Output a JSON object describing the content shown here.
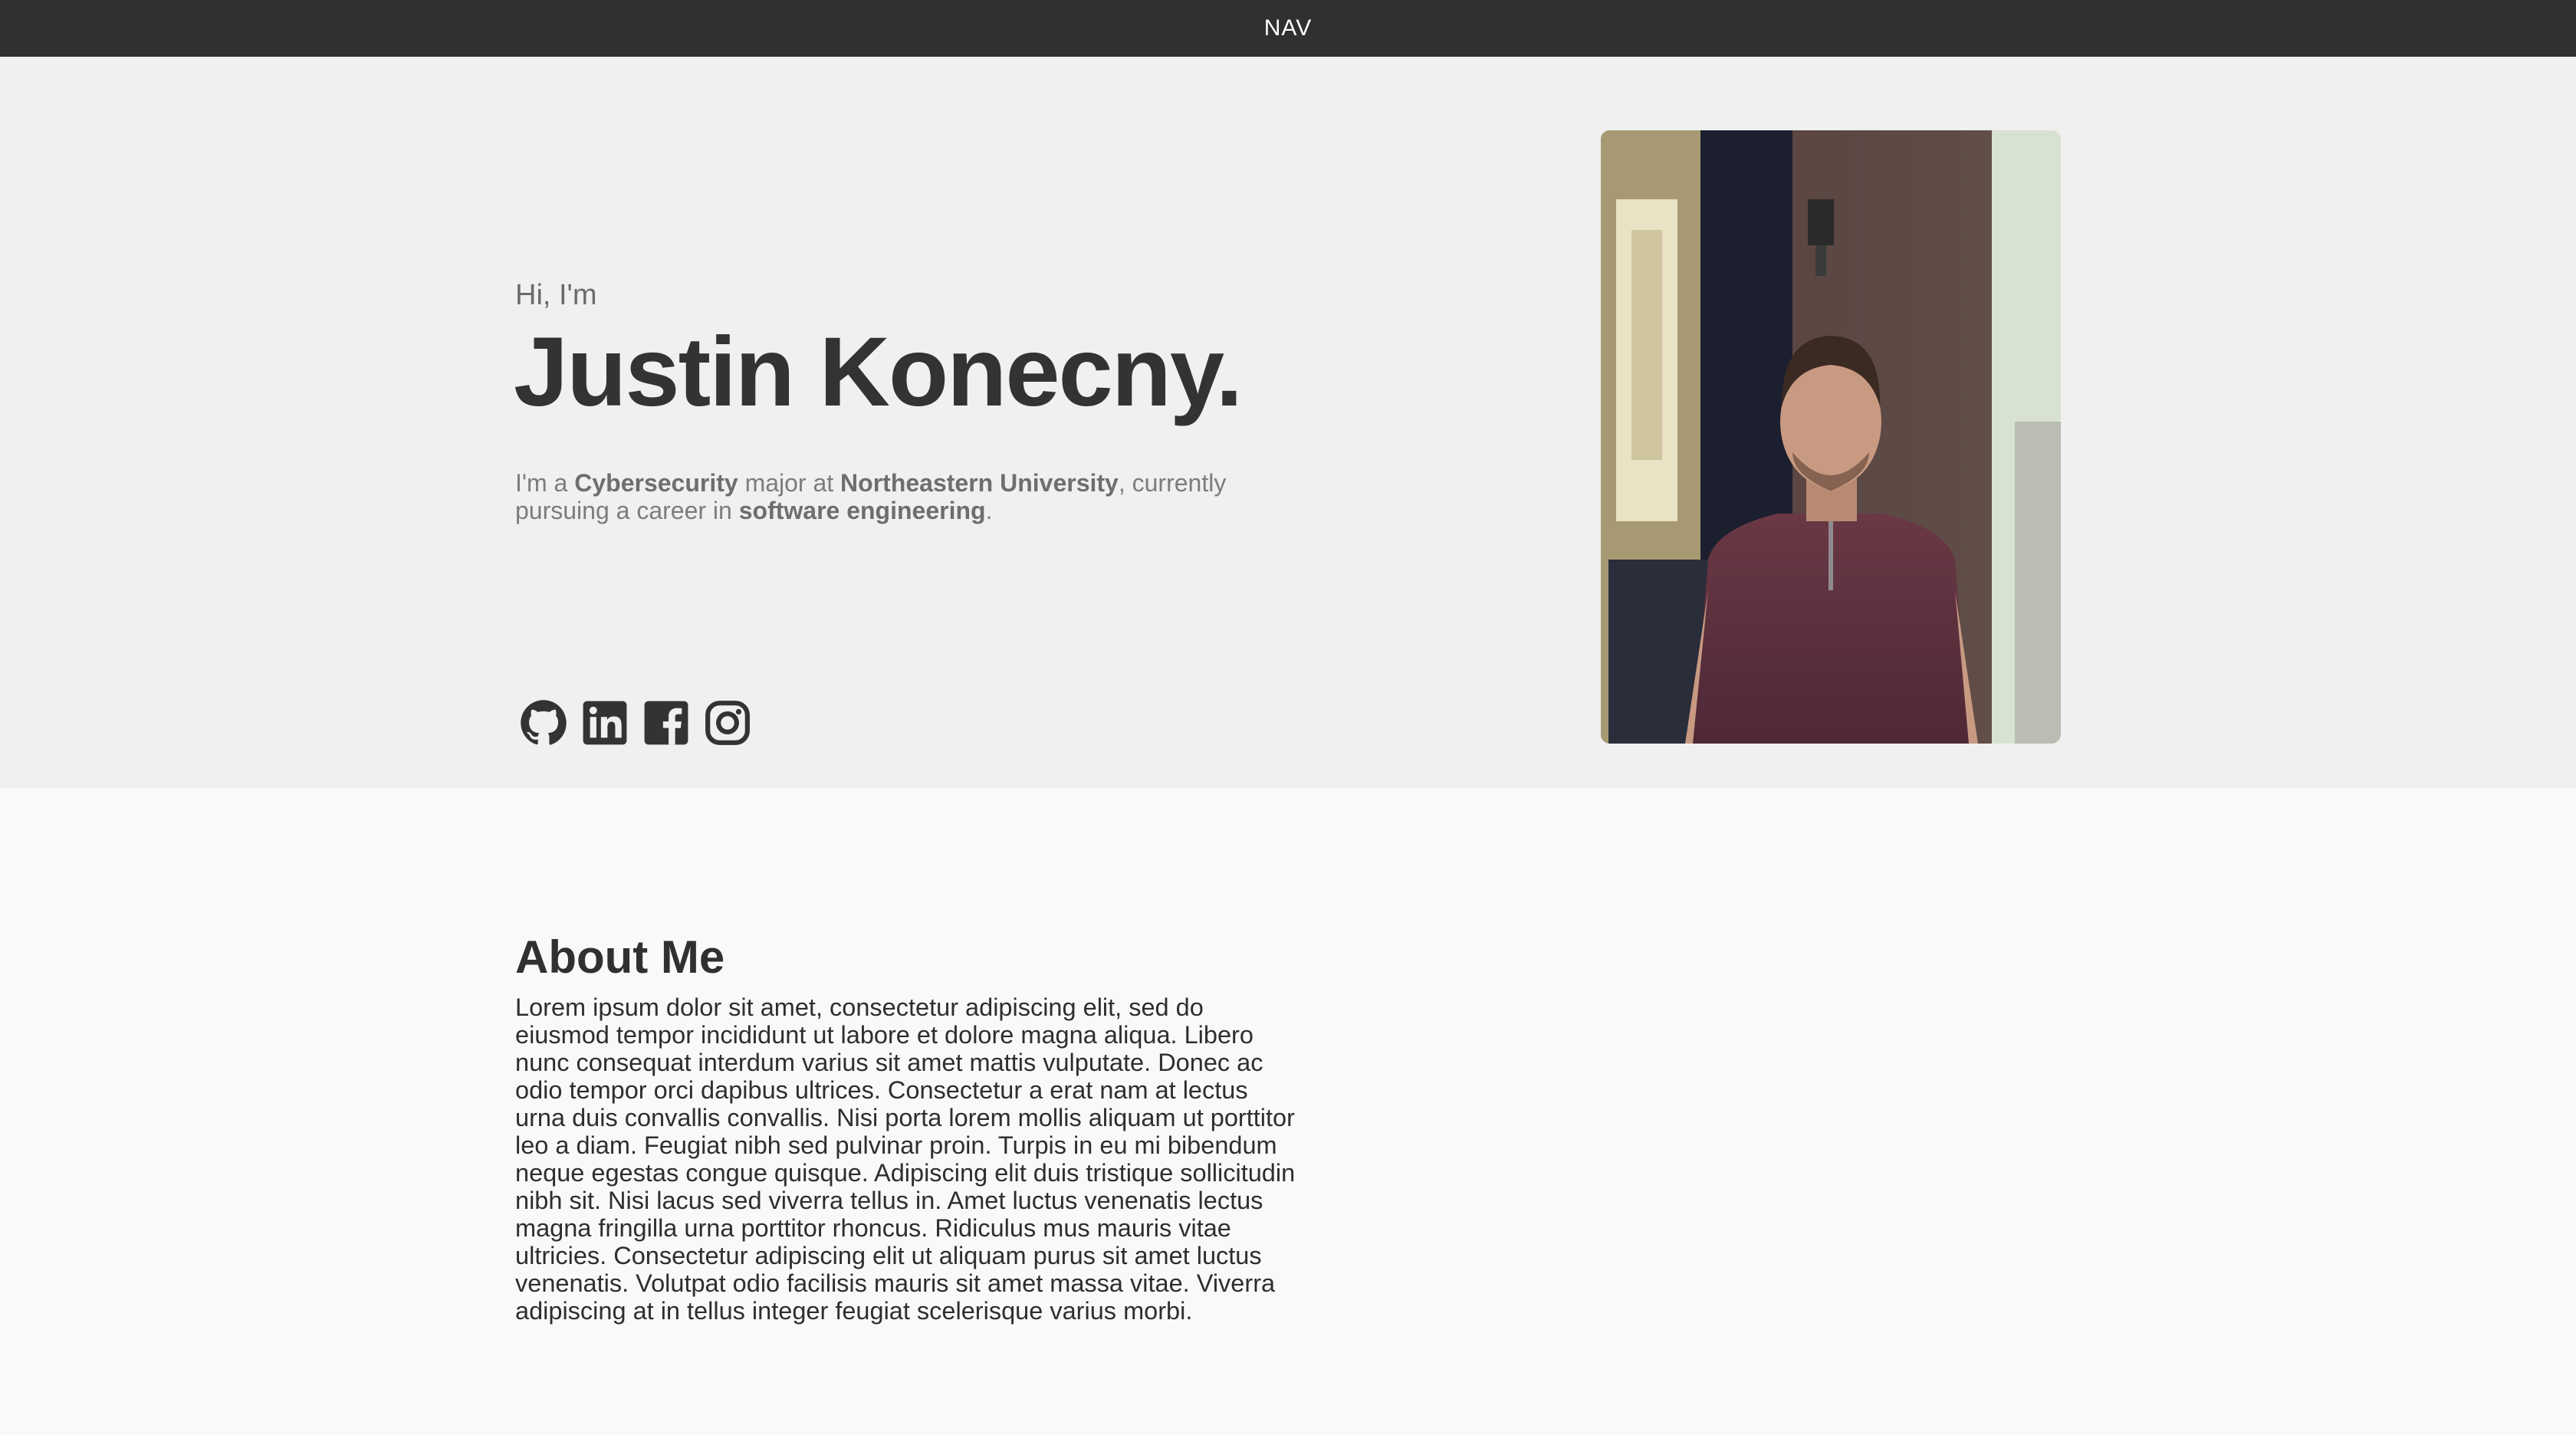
{
  "nav": {
    "label": "NAV"
  },
  "hero": {
    "greeting": "Hi, I'm",
    "name": "Justin Konecny.",
    "desc": {
      "p1": "I'm a ",
      "major": "Cybersecurity",
      "p2": " major at ",
      "university": "Northeastern University",
      "p3": ", currently pursuing a career in ",
      "career": "software engineering",
      "p4": "."
    }
  },
  "socials": [
    {
      "icon": "github-icon"
    },
    {
      "icon": "linkedin-icon"
    },
    {
      "icon": "facebook-icon"
    },
    {
      "icon": "instagram-icon"
    }
  ],
  "about": {
    "title": "About Me",
    "body": "Lorem ipsum dolor sit amet, consectetur adipiscing elit, sed do eiusmod tempor incididunt ut labore et dolore magna aliqua. Libero nunc consequat interdum varius sit amet mattis vulputate. Donec ac odio tempor orci dapibus ultrices. Consectetur a erat nam at lectus urna duis convallis convallis. Nisi porta lorem mollis aliquam ut porttitor leo a diam. Feugiat nibh sed pulvinar proin. Turpis in eu mi bibendum neque egestas congue quisque. Adipiscing elit duis tristique sollicitudin nibh sit. Nisi lacus sed viverra tellus in. Amet luctus venenatis lectus magna fringilla urna porttitor rhoncus. Ridiculus mus mauris vitae ultricies. Consectetur adipiscing elit ut aliquam purus sit amet luctus venenatis. Volutpat odio facilisis mauris sit amet massa vitae. Viverra adipiscing at in tellus integer feugiat scelerisque varius morbi."
  },
  "colors": {
    "nav_bg": "#303030",
    "hero_bg": "#f0f0f0",
    "page_bg": "#f9f9f9",
    "heading": "#333333",
    "muted": "#7c7c7c"
  }
}
